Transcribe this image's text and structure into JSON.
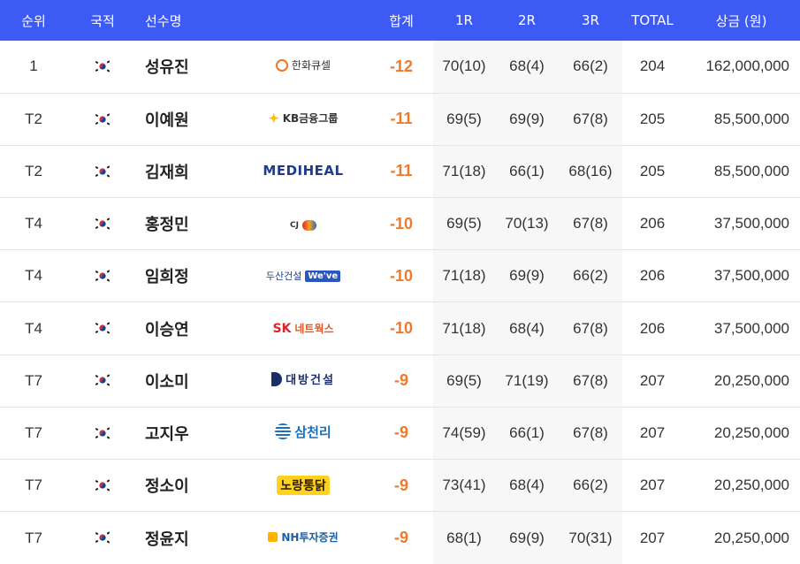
{
  "header": {
    "rank": "순위",
    "nationality": "국적",
    "player": "선수명",
    "total": "합계",
    "r1": "1R",
    "r2": "2R",
    "r3": "3R",
    "total_strokes": "TOTAL",
    "prize": "상금 (원)"
  },
  "colors": {
    "header_bg": "#3d5af5",
    "score_accent": "#f0792b",
    "round_col_bg": "#f7f7f7"
  },
  "rows": [
    {
      "rank": "1",
      "flag": "korea-flag-icon",
      "name": "성유진",
      "sponsor_logo": "hanwha-qcells-logo",
      "sponsor_text": "한화큐셀",
      "score": "-12",
      "r1": "70(10)",
      "r2": "68(4)",
      "r3": "66(2)",
      "total": "204",
      "prize": "162,000,000"
    },
    {
      "rank": "T2",
      "flag": "korea-flag-icon",
      "name": "이예원",
      "sponsor_logo": "kb-financial-logo",
      "sponsor_text": "KB금융그룹",
      "score": "-11",
      "r1": "69(5)",
      "r2": "69(9)",
      "r3": "67(8)",
      "total": "205",
      "prize": "85,500,000"
    },
    {
      "rank": "T2",
      "flag": "korea-flag-icon",
      "name": "김재희",
      "sponsor_logo": "mediheal-logo",
      "sponsor_text": "MEDIHEAL",
      "score": "-11",
      "r1": "71(18)",
      "r2": "66(1)",
      "r3": "68(16)",
      "total": "205",
      "prize": "85,500,000"
    },
    {
      "rank": "T4",
      "flag": "korea-flag-icon",
      "name": "홍정민",
      "sponsor_logo": "cj-logo",
      "sponsor_text": "CJ",
      "score": "-10",
      "r1": "69(5)",
      "r2": "70(13)",
      "r3": "67(8)",
      "total": "206",
      "prize": "37,500,000"
    },
    {
      "rank": "T4",
      "flag": "korea-flag-icon",
      "name": "임희정",
      "sponsor_logo": "doosan-weve-logo",
      "sponsor_text": "두산건설",
      "sponsor_badge": "We've",
      "score": "-10",
      "r1": "71(18)",
      "r2": "69(9)",
      "r3": "66(2)",
      "total": "206",
      "prize": "37,500,000"
    },
    {
      "rank": "T4",
      "flag": "korea-flag-icon",
      "name": "이승연",
      "sponsor_logo": "sk-networks-logo",
      "sponsor_text": "SK",
      "sponsor_sub": "네트웍스",
      "score": "-10",
      "r1": "71(18)",
      "r2": "68(4)",
      "r3": "67(8)",
      "total": "206",
      "prize": "37,500,000"
    },
    {
      "rank": "T7",
      "flag": "korea-flag-icon",
      "name": "이소미",
      "sponsor_logo": "daebang-logo",
      "sponsor_text": "대방건설",
      "score": "-9",
      "r1": "69(5)",
      "r2": "71(19)",
      "r3": "67(8)",
      "total": "207",
      "prize": "20,250,000"
    },
    {
      "rank": "T7",
      "flag": "korea-flag-icon",
      "name": "고지우",
      "sponsor_logo": "samchully-logo",
      "sponsor_text": "삼천리",
      "score": "-9",
      "r1": "74(59)",
      "r2": "66(1)",
      "r3": "67(8)",
      "total": "207",
      "prize": "20,250,000"
    },
    {
      "rank": "T7",
      "flag": "korea-flag-icon",
      "name": "정소이",
      "sponsor_logo": "norang-tongdak-logo",
      "sponsor_text": "노랑통닭",
      "score": "-9",
      "r1": "73(41)",
      "r2": "68(4)",
      "r3": "66(2)",
      "total": "207",
      "prize": "20,250,000"
    },
    {
      "rank": "T7",
      "flag": "korea-flag-icon",
      "name": "정윤지",
      "sponsor_logo": "nh-securities-logo",
      "sponsor_text": "NH투자증권",
      "score": "-9",
      "r1": "68(1)",
      "r2": "69(9)",
      "r3": "70(31)",
      "total": "207",
      "prize": "20,250,000"
    }
  ]
}
